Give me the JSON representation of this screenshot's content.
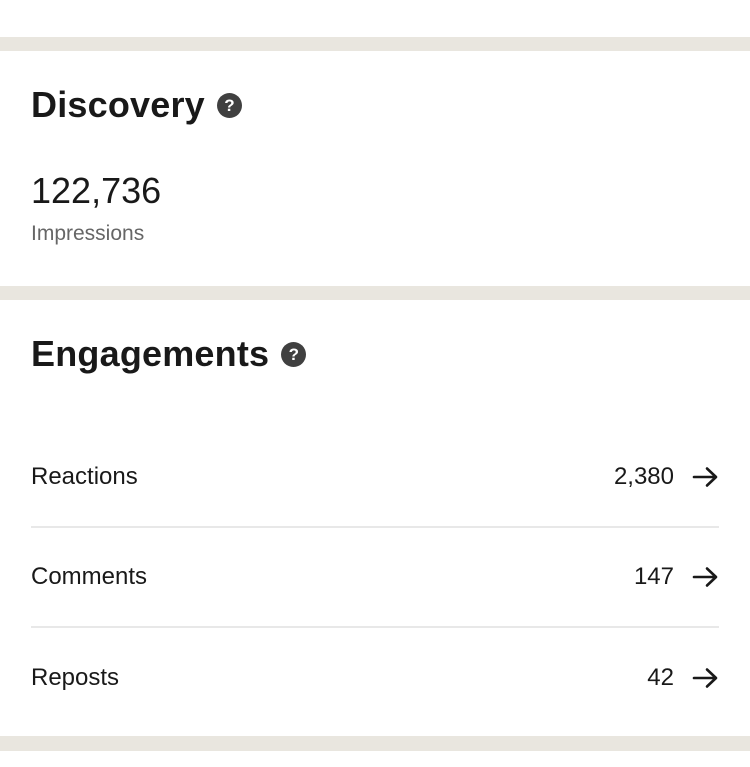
{
  "discovery": {
    "title": "Discovery",
    "help_icon": "question-circle-icon",
    "impressions_value": "122,736",
    "impressions_label": "Impressions"
  },
  "engagements": {
    "title": "Engagements",
    "help_icon": "question-circle-icon",
    "rows": [
      {
        "label": "Reactions",
        "value": "2,380",
        "icon": "arrow-right-icon"
      },
      {
        "label": "Comments",
        "value": "147",
        "icon": "arrow-right-icon"
      },
      {
        "label": "Reposts",
        "value": "42",
        "icon": "arrow-right-icon"
      }
    ]
  },
  "help_glyph": "?",
  "colors": {
    "page_background": "#e9e6df",
    "card_background": "#ffffff",
    "text_primary": "#191919",
    "text_secondary": "#666666",
    "divider": "#e8e8e8",
    "help_icon_background": "#404040"
  }
}
